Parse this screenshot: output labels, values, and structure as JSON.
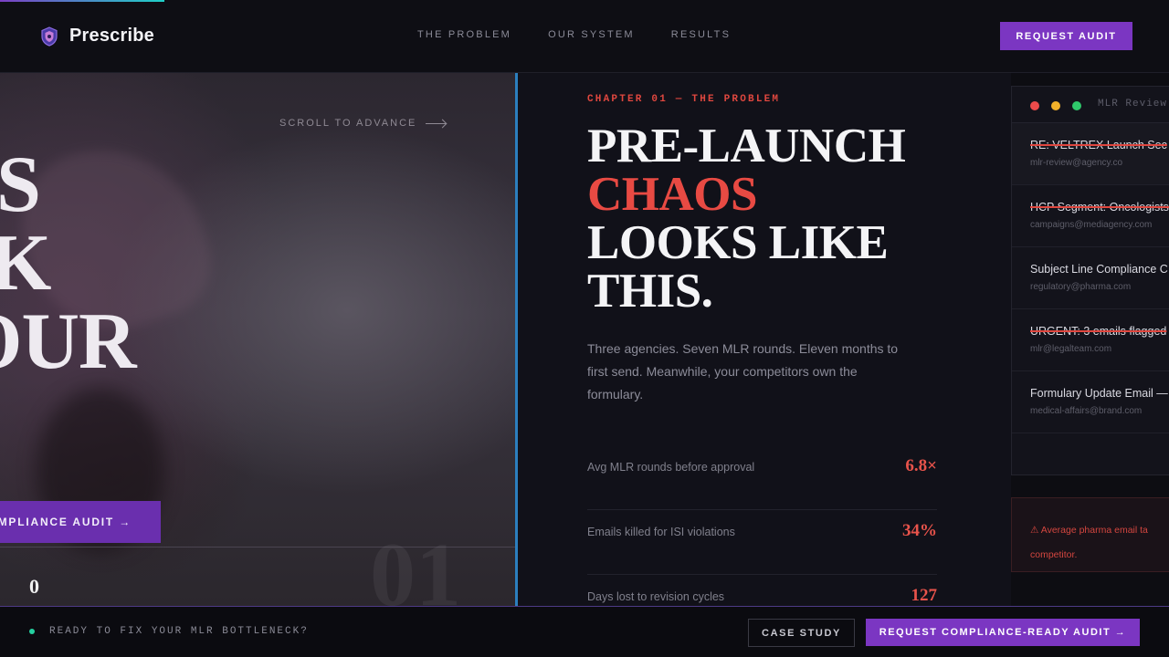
{
  "brand": {
    "name": "Prescribe",
    "icon": "shield-logo-icon",
    "accent": "#7b36c2"
  },
  "nav": {
    "items": [
      "THE PROBLEM",
      "OUR SYSTEM",
      "RESULTS"
    ],
    "cta": "REQUEST AUDIT"
  },
  "hero": {
    "scroll_hint": "SCROLL TO ADVANCE",
    "words": [
      "S",
      "K",
      "OUR"
    ],
    "cta": "MPLIANCE AUDIT →",
    "counter": "0",
    "ghost_number": "01"
  },
  "chapter": {
    "label": "CHAPTER 01 — THE PROBLEM",
    "headline": {
      "line1": "PRE-LAUNCH",
      "line2": "CHAOS",
      "line3": "LOOKS LIKE",
      "line4": "THIS."
    },
    "lede": "Three agencies. Seven MLR rounds. Eleven months to first send. Meanwhile, your competitors own the formulary.",
    "stats": [
      {
        "label": "Avg MLR rounds before approval",
        "value": "6.8×"
      },
      {
        "label": "Emails killed for ISI violations",
        "value": "34%"
      },
      {
        "label": "Days lost to revision cycles",
        "value": "127"
      }
    ],
    "accent_color": "#e84a43"
  },
  "inbox": {
    "title": "MLR Review",
    "emails": [
      {
        "subject": "RE: VELTREX Launch Sec",
        "from": "mlr-review@agency.co",
        "flagged": true
      },
      {
        "subject": "HCP Segment: Oncologists",
        "from": "campaigns@mediagency.com",
        "flagged": true
      },
      {
        "subject": "Subject Line Compliance C",
        "from": "regulatory@pharma.com",
        "flagged": false
      },
      {
        "subject": "URGENT: 3 emails flagged",
        "from": "mlr@legalteam.com",
        "flagged": true
      },
      {
        "subject": "Formulary Update Email —",
        "from": "medical-affairs@brand.com",
        "flagged": false
      }
    ],
    "alert": "⚠ Average pharma email ta competitor."
  },
  "footer": {
    "ready": "READY TO FIX YOUR MLR BOTTLENECK?",
    "case_study": "CASE STUDY",
    "request": "REQUEST COMPLIANCE-READY AUDIT →",
    "live_color": "#25d0a0"
  }
}
